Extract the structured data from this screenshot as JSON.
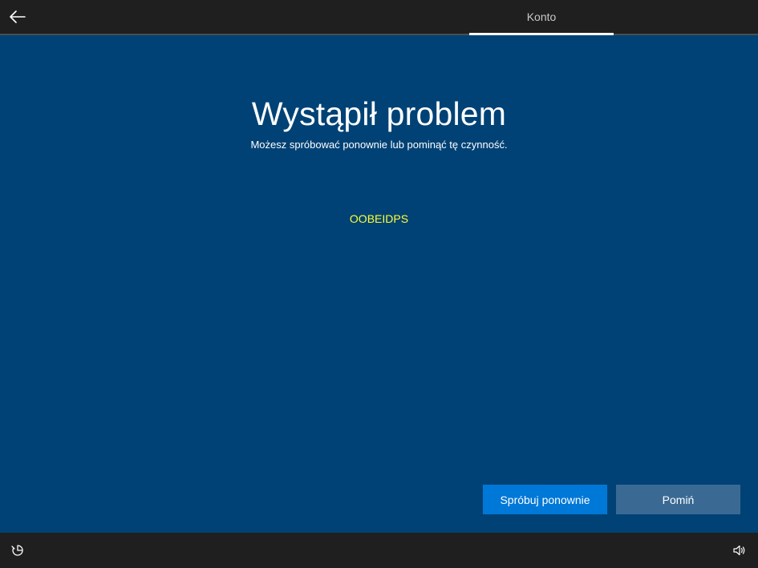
{
  "header": {
    "back_icon": "arrow-left-icon",
    "tab_label": "Konto"
  },
  "main": {
    "title": "Wystąpił problem",
    "subtitle": "Możesz spróbować ponownie lub pominąć tę czynność.",
    "error_code": "OOBEIDPS",
    "retry_button": "Spróbuj ponownie",
    "skip_button": "Pomiń"
  },
  "footer": {
    "ease_of_access_icon": "ease-of-access-icon",
    "volume_icon": "volume-icon"
  },
  "colors": {
    "background": "#004275",
    "bar": "#1f1f1f",
    "primary_button": "#0078d7",
    "secondary_button": "#3a6a94",
    "error_code_text": "#ffff33"
  }
}
